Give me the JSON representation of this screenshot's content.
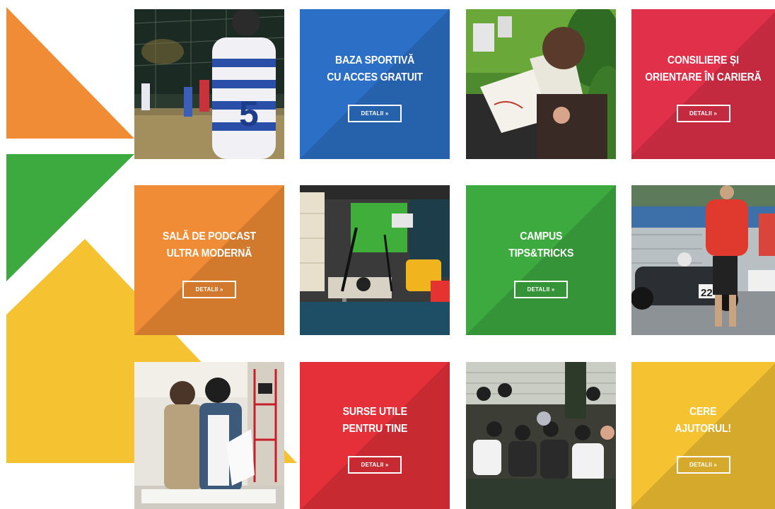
{
  "colors": {
    "orange": "#f08c35",
    "orange_dark": "#d97420",
    "green": "#3daa3f",
    "green_dark": "#2c8f31",
    "yellow": "#f5c232",
    "yellow_dark": "#e0a920",
    "blue": "#2b6fc6",
    "blue_dark": "#1e57a8",
    "red": "#e5303a",
    "red_dark": "#c9242f",
    "crimson": "#e0304a",
    "crimson_dark": "#c8213c"
  },
  "tiles": [
    {
      "type": "photo",
      "name": "football-photo",
      "subject": "football-players-night"
    },
    {
      "type": "cta",
      "name": "sports-base",
      "color": "blue",
      "title": [
        "BAZA SPORTIVĂ",
        "CU ACCES GRATUIT"
      ],
      "button": "DETALII »"
    },
    {
      "type": "photo",
      "name": "drawing-photo",
      "subject": "student-drawing-on-grass"
    },
    {
      "type": "cta",
      "name": "career-counseling",
      "color": "crimson",
      "title": [
        "CONSILIERE ȘI",
        "ORIENTARE ÎN CARIERĂ"
      ],
      "button": "DETALII »"
    },
    {
      "type": "cta",
      "name": "podcast-room",
      "color": "orange",
      "title": [
        "SALĂ DE PODCAST",
        "ULTRA MODERNĂ"
      ],
      "button": "DETALII »"
    },
    {
      "type": "photo",
      "name": "podcast-studio-photo",
      "subject": "podcast-studio-green-screen"
    },
    {
      "type": "cta",
      "name": "campus-tips",
      "color": "green",
      "title": [
        "CAMPUS",
        "TIPS&TRICKS"
      ],
      "button": "DETALII »"
    },
    {
      "type": "photo",
      "name": "race-car-photo",
      "subject": "formula-student-race-car"
    },
    {
      "type": "photo",
      "name": "exhibition-photo",
      "subject": "students-at-exhibition"
    },
    {
      "type": "cta",
      "name": "useful-resources",
      "color": "red",
      "title": [
        "SURSE UTILE",
        "PENTRU TINE"
      ],
      "button": "DETALII »"
    },
    {
      "type": "photo",
      "name": "audience-photo",
      "subject": "students-sitting-outdoors"
    },
    {
      "type": "cta",
      "name": "ask-for-help",
      "color": "yellow",
      "title": [
        "CERE",
        "AJUTORUL!"
      ],
      "button": "DETALII »"
    }
  ]
}
